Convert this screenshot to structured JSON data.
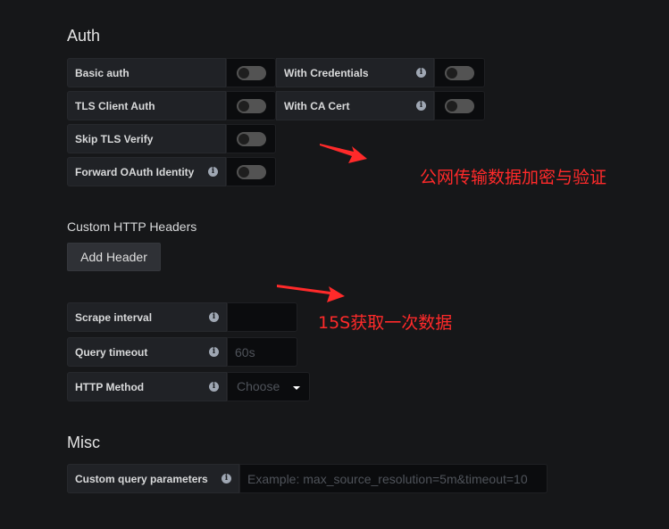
{
  "auth": {
    "title": "Auth",
    "fields": [
      {
        "label": "Basic auth",
        "enabled": false
      },
      {
        "label": "With Credentials",
        "enabled": false
      },
      {
        "label": "TLS Client Auth",
        "enabled": false
      },
      {
        "label": "With CA Cert",
        "enabled": false
      },
      {
        "label": "Skip TLS Verify",
        "enabled": false
      },
      {
        "label": "Forward OAuth Identity",
        "enabled": false
      }
    ]
  },
  "headers": {
    "title": "Custom HTTP Headers",
    "add_label": "Add Header"
  },
  "prom": {
    "scrape_label": "Scrape interval",
    "scrape_value": "",
    "timeout_label": "Query timeout",
    "timeout_placeholder": "60s",
    "method_label": "HTTP Method",
    "method_placeholder": "Choose"
  },
  "misc": {
    "title": "Misc",
    "custom_label": "Custom query parameters",
    "custom_placeholder": "Example: max_source_resolution=5m&timeout=10"
  },
  "annotations": {
    "note1": "公网传输数据加密与验证",
    "note2": "15S获取一次数据",
    "color": "#ff2a2a"
  },
  "info_icon": "i"
}
